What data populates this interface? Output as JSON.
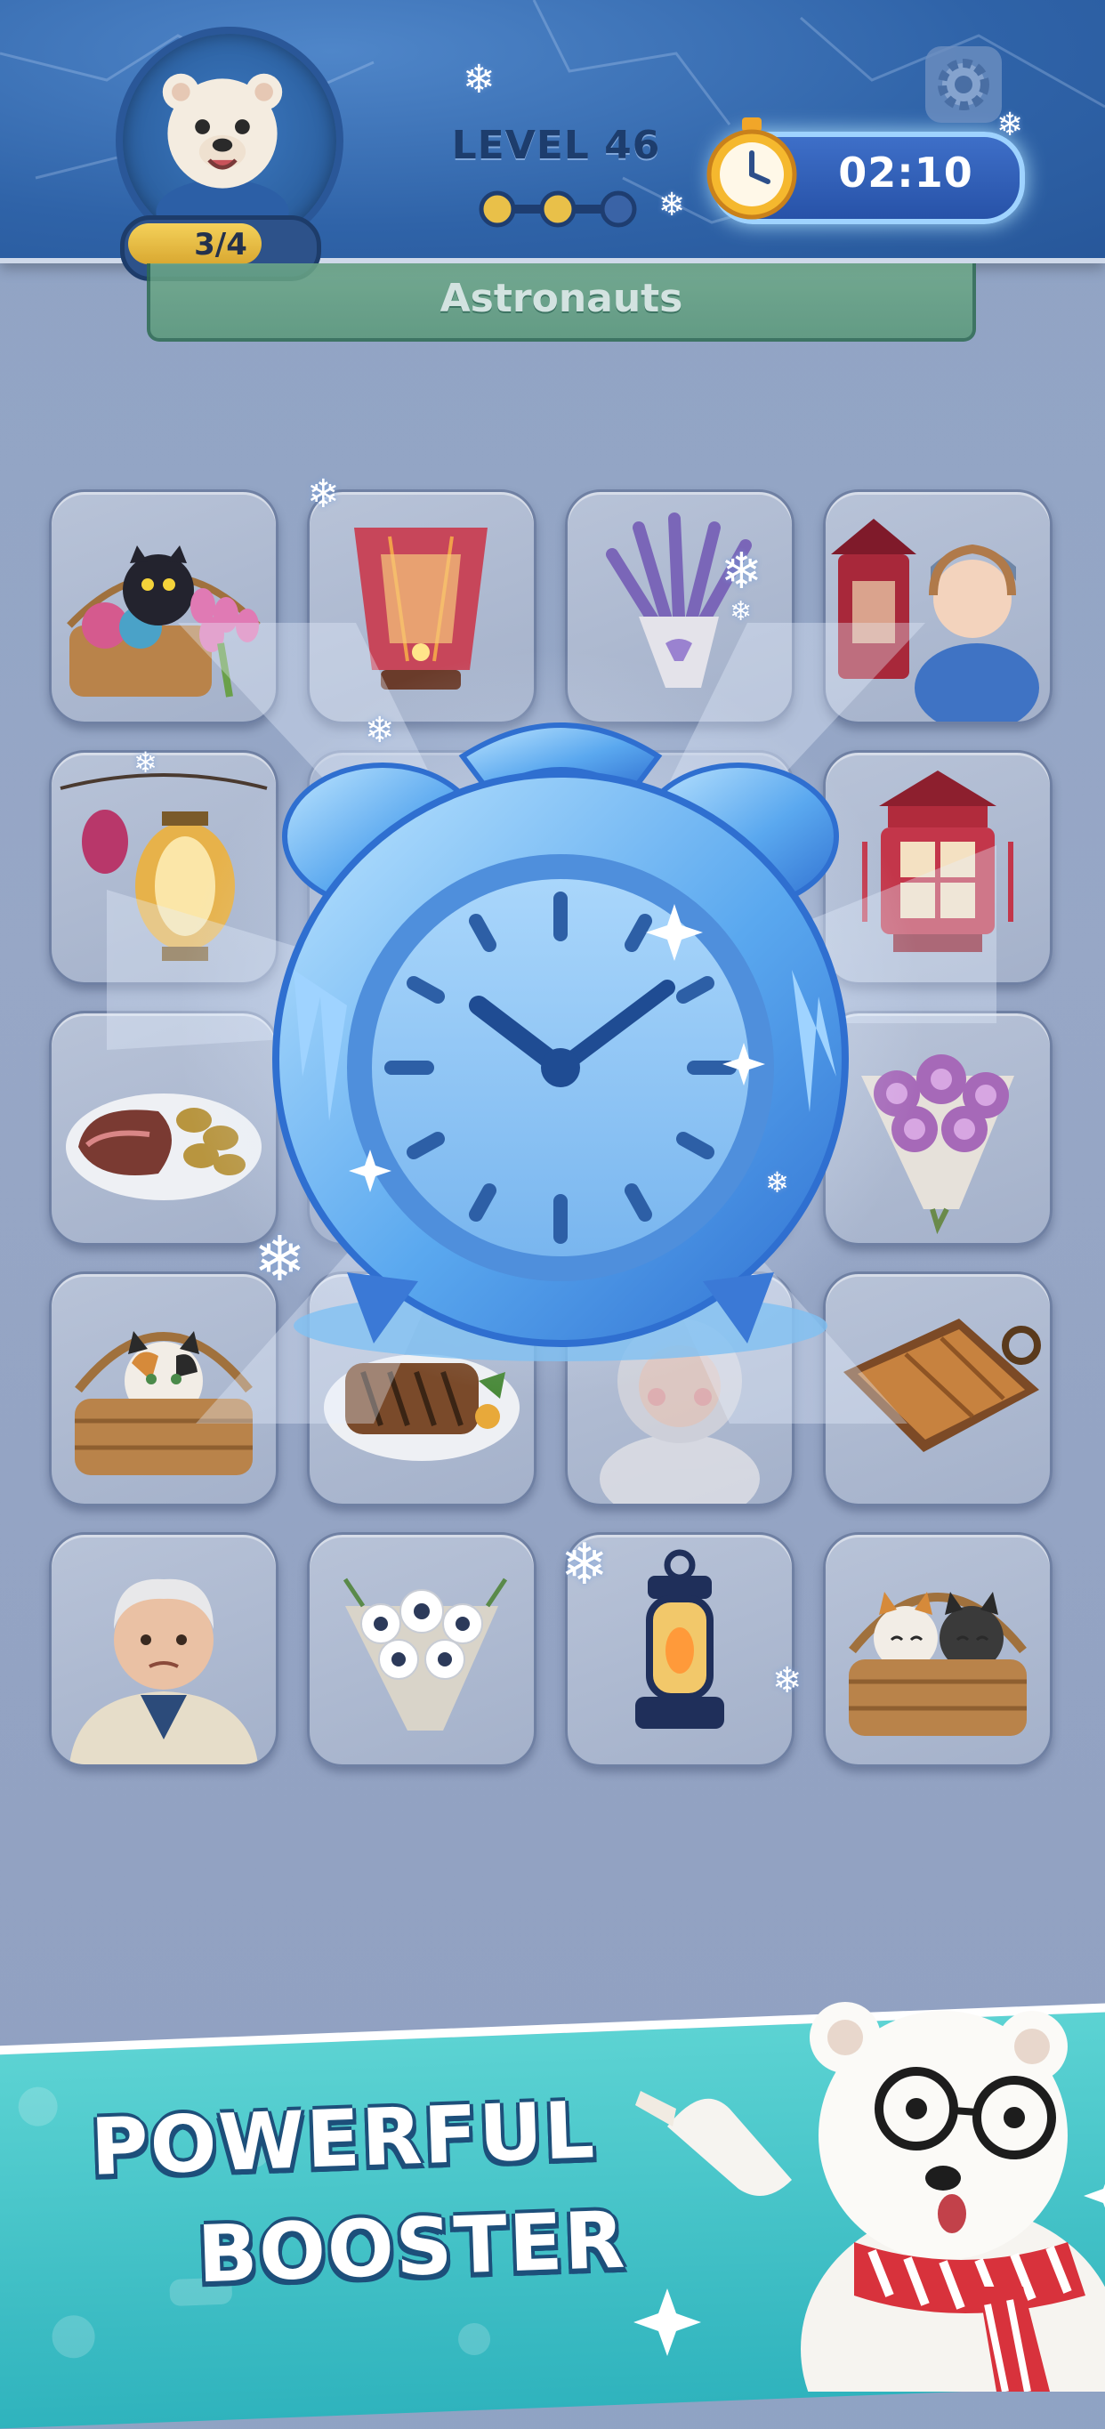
{
  "hud": {
    "level_progress": "3/4",
    "level_title": "LEVEL 46",
    "timer": "02:10",
    "stage_dots": {
      "total": 3,
      "completed": 2
    }
  },
  "category": {
    "label": "Astronauts"
  },
  "grid": {
    "tiles": [
      {
        "icon": "cat-basket-tulips-icon",
        "covered": false
      },
      {
        "icon": "paper-lantern-icon",
        "covered": false
      },
      {
        "icon": "lavender-bouquet-icon",
        "covered": false
      },
      {
        "icon": "girl-lantern-icon",
        "covered": false
      },
      {
        "icon": "hanging-lanterns-icon",
        "covered": false
      },
      {
        "icon": "hidden-tile",
        "covered": true
      },
      {
        "icon": "hidden-tile",
        "covered": true
      },
      {
        "icon": "red-pagoda-lantern-icon",
        "covered": false
      },
      {
        "icon": "roast-beef-plate-icon",
        "covered": false
      },
      {
        "icon": "hidden-tile",
        "covered": true
      },
      {
        "icon": "hidden-tile",
        "covered": true
      },
      {
        "icon": "peony-bouquet-icon",
        "covered": false
      },
      {
        "icon": "kitten-basket-icon",
        "covered": false
      },
      {
        "icon": "grilled-fish-plate-icon",
        "covered": false
      },
      {
        "icon": "hooded-child-icon",
        "covered": false
      },
      {
        "icon": "baked-pie-pan-icon",
        "covered": false
      },
      {
        "icon": "elderly-man-icon",
        "covered": false
      },
      {
        "icon": "daisy-bouquet-icon",
        "covered": false
      },
      {
        "icon": "oil-lantern-icon",
        "covered": false
      },
      {
        "icon": "two-kittens-basket-icon",
        "covered": false
      }
    ]
  },
  "booster": {
    "icon": "frozen-alarm-clock-icon"
  },
  "promo": {
    "line1": "POWERFUL",
    "line2": "BOOSTER"
  },
  "colors": {
    "header": "#2f63a8",
    "timer_glow": "#9fd3ff",
    "promo_teal": "#2fb3bd",
    "banner_green": "#5b9a7a"
  }
}
